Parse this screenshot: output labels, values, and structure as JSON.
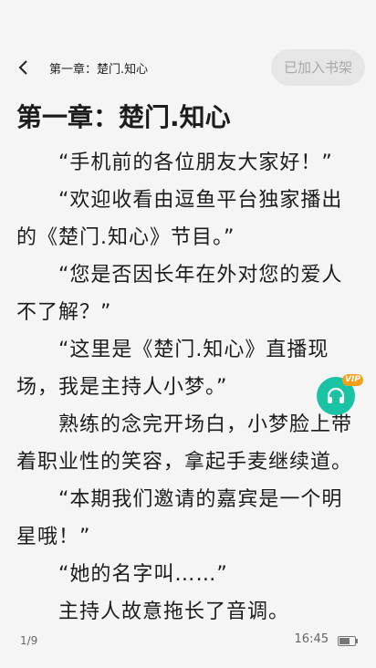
{
  "header": {
    "chapter_name": "第一章：楚门.知心",
    "shelf_button": "已加入书架"
  },
  "article": {
    "title": "第一章：楚门.知心",
    "paragraphs": [
      "“手机前的各位朋友大家好！”",
      "“欢迎收看由逗鱼平台独家播出的《楚门.知心》节目。”",
      "“您是否因长年在外对您的爱人不了解？”",
      "“这里是《楚门.知心》直播现场，我是主持人小梦。”",
      "熟练的念完开场白，小梦脸上带着职业性的笑容，拿起手麦继续道。",
      "“本期我们邀请的嘉宾是一个明星哦！”",
      "“她的名字叫……”",
      "主持人故意拖长了音调。"
    ]
  },
  "audio": {
    "badge": "VIP"
  },
  "footer": {
    "page": "1/9",
    "time": "16:45",
    "battery_level": 0.7
  },
  "colors": {
    "background": "#f5f5f5",
    "accent": "#19c3a4",
    "vip": "#f6a11c"
  }
}
